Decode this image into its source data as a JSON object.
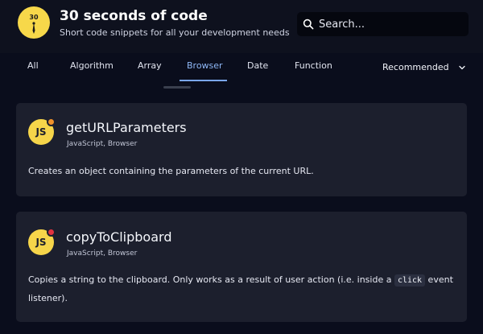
{
  "header": {
    "logo_text": "30",
    "title": "30 seconds of code",
    "subtitle": "Short code snippets for all your development needs",
    "search_placeholder": "Search..."
  },
  "tabs": [
    {
      "label": "All",
      "active": false
    },
    {
      "label": "Algorithm",
      "active": false
    },
    {
      "label": "Array",
      "active": false
    },
    {
      "label": "Browser",
      "active": true
    },
    {
      "label": "Date",
      "active": false
    },
    {
      "label": "Function",
      "active": false
    }
  ],
  "sort": {
    "label": "Recommended",
    "icon": "chevron-down-icon"
  },
  "cards": [
    {
      "badge": "JS",
      "title": "getURLParameters",
      "tags": "JavaScript, Browser",
      "description": "Creates an object containing the parameters of the current URL.",
      "status_color": "#f0922b"
    },
    {
      "badge": "JS",
      "title": "copyToClipboard",
      "tags": "JavaScript, Browser",
      "description_before": "Copies a string to the clipboard. Only works as a result of user action (i.e. inside a ",
      "description_code": "click",
      "description_after": " event listener).",
      "status_color": "#e2333f"
    }
  ],
  "colors": {
    "background": "#0a0d1c",
    "card": "#1c1f2d",
    "accent": "#7aa6ef",
    "brand_yellow": "#f6d54a"
  }
}
